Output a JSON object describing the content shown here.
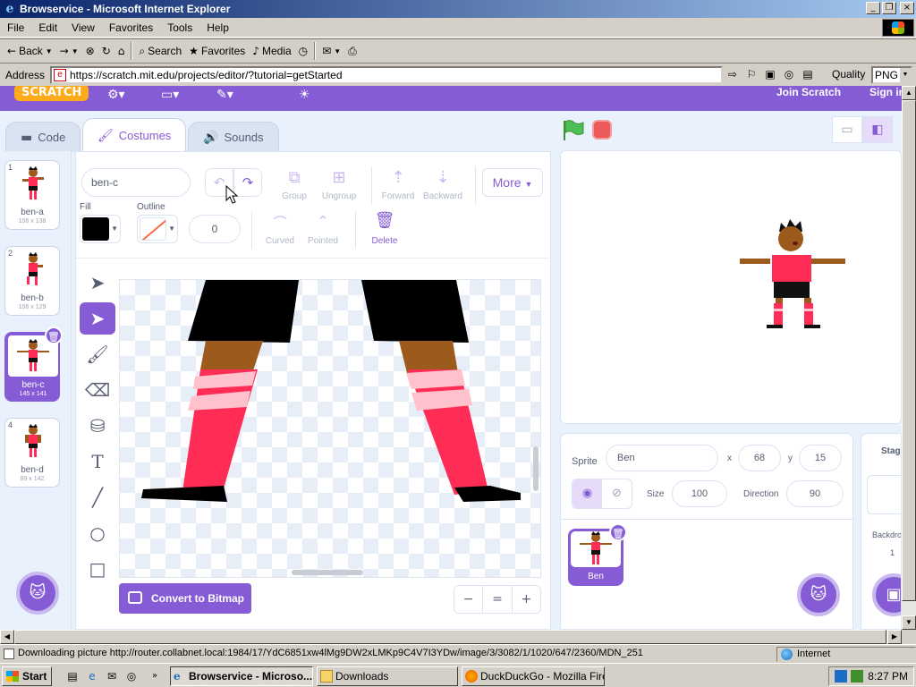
{
  "window": {
    "title": "Browservice - Microsoft Internet Explorer",
    "controls": [
      "_",
      "❐",
      "×"
    ]
  },
  "menu": [
    "File",
    "Edit",
    "View",
    "Favorites",
    "Tools",
    "Help"
  ],
  "toolbar": {
    "back": "Back",
    "search": "Search",
    "favorites": "Favorites",
    "media": "Media"
  },
  "address": {
    "label": "Address",
    "url": "https://scratch.mit.edu/projects/editor/?tutorial=getStarted",
    "quality_label": "Quality",
    "quality_value": "PNG"
  },
  "scratch": {
    "logo": "SCRATCH",
    "join": "Join Scratch",
    "sign_in": "Sign in",
    "tabs": {
      "code": "Code",
      "costumes": "Costumes",
      "sounds": "Sounds"
    },
    "costumes": [
      {
        "num": "1",
        "name": "ben-a",
        "size": "106 x 138"
      },
      {
        "num": "2",
        "name": "ben-b",
        "size": "106 x 129"
      },
      {
        "num": "3",
        "name": "ben-c",
        "size": "145 x 141"
      },
      {
        "num": "4",
        "name": "ben-d",
        "size": "89 x 142"
      }
    ],
    "editor": {
      "costume_name": "ben-c",
      "group": "Group",
      "ungroup": "Ungroup",
      "forward": "Forward",
      "backward": "Backward",
      "more": "More",
      "fill_label": "Fill",
      "outline_label": "Outline",
      "outline_width": "0",
      "curved": "Curved",
      "pointed": "Pointed",
      "delete": "Delete",
      "convert": "Convert to Bitmap",
      "zoom_out": "−",
      "zoom_reset": "=",
      "zoom_in": "+"
    },
    "sprite": {
      "label": "Sprite",
      "name": "Ben",
      "x_label": "x",
      "x": "68",
      "y_label": "y",
      "y": "15",
      "size_label": "Size",
      "size": "100",
      "direction_label": "Direction",
      "direction": "90",
      "tile_name": "Ben"
    },
    "stage": {
      "label": "Stage",
      "backdrops_label": "Backdrops",
      "backdrops_count": "1"
    },
    "colors": {
      "accent": "#855cd6",
      "fill": "#000000",
      "shirt": "#ff2d55",
      "skin": "#9c5b1c"
    }
  },
  "status": {
    "message": "Downloading picture http://router.collabnet.local:1984/17/YdC6851xw4lMg9DW2xLMKp9C4V7I3YDw/image/3/3082/1/1020/647/2360/MDN_251",
    "zone": "Internet"
  },
  "taskbar": {
    "start": "Start",
    "tasks": [
      {
        "label": "Browservice - Microso...",
        "active": true
      },
      {
        "label": "Downloads",
        "active": false
      },
      {
        "label": "DuckDuckGo - Mozilla Fire...",
        "active": false
      }
    ],
    "clock": "8:27 PM"
  }
}
